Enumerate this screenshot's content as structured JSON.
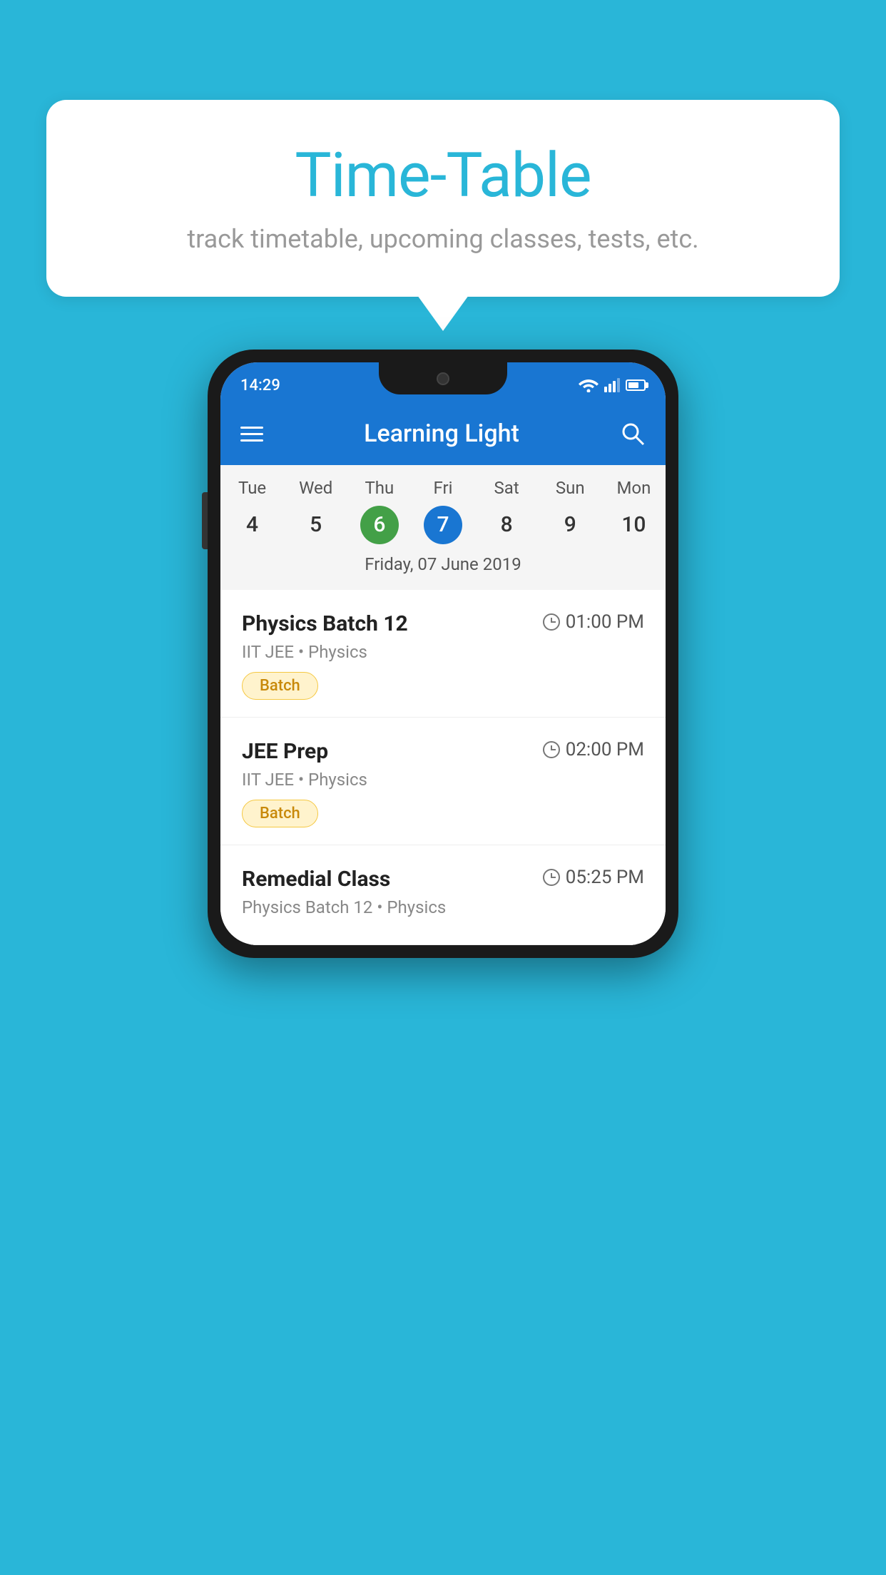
{
  "background_color": "#29b6d8",
  "speech_bubble": {
    "title": "Time-Table",
    "subtitle": "track timetable, upcoming classes, tests, etc."
  },
  "phone": {
    "status_bar": {
      "time": "14:29"
    },
    "app_bar": {
      "title": "Learning Light"
    },
    "calendar": {
      "day_headers": [
        "Tue",
        "Wed",
        "Thu",
        "Fri",
        "Sat",
        "Sun",
        "Mon"
      ],
      "day_numbers": [
        "4",
        "5",
        "6",
        "7",
        "8",
        "9",
        "10"
      ],
      "today_index": 2,
      "selected_index": 3,
      "selected_date_label": "Friday, 07 June 2019"
    },
    "schedule_items": [
      {
        "title": "Physics Batch 12",
        "time": "01:00 PM",
        "subtitle": "IIT JEE • Physics",
        "tag": "Batch"
      },
      {
        "title": "JEE Prep",
        "time": "02:00 PM",
        "subtitle": "IIT JEE • Physics",
        "tag": "Batch"
      },
      {
        "title": "Remedial Class",
        "time": "05:25 PM",
        "subtitle": "Physics Batch 12 • Physics",
        "tag": ""
      }
    ]
  }
}
